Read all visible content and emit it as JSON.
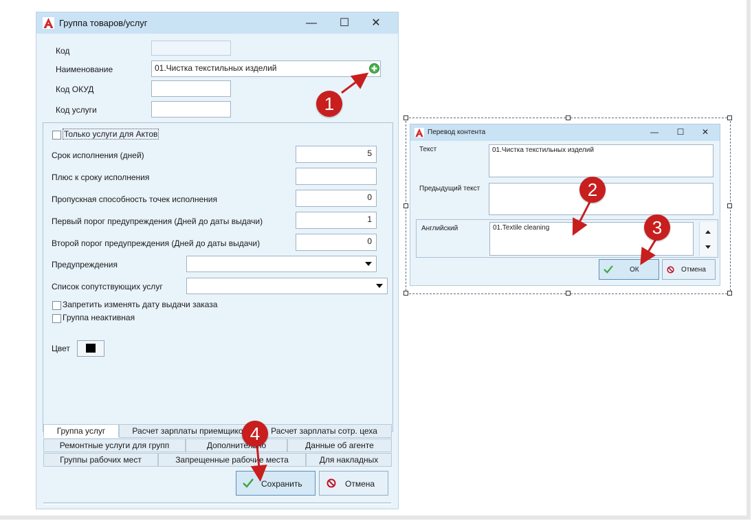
{
  "main_window": {
    "title": "Группа товаров/услуг",
    "controls": {
      "minimize": "—",
      "maximize": "☐",
      "close": "✕"
    },
    "fields": {
      "code_label": "Код",
      "code_value": "",
      "name_label": "Наименование",
      "name_value": "01.Чистка текстильных изделий",
      "okud_label": "Код ОКУД",
      "okud_value": "",
      "service_code_label": "Код услуги",
      "service_code_value": ""
    },
    "panel": {
      "only_acts_label": "Только услуги для Актов",
      "duration_label": "Срок исполнения (дней)",
      "duration_value": "5",
      "plus_duration_label": "Плюс к сроку исполнения",
      "plus_duration_value": "",
      "throughput_label": "Пропускная способность точек исполнения",
      "throughput_value": "0",
      "warn1_label": "Первый порог предупреждения (Дней до даты выдачи)",
      "warn1_value": "1",
      "warn2_label": "Второй порог предупреждения (Дней до даты выдачи)",
      "warn2_value": "0",
      "warnings_label": "Предупреждения",
      "warnings_value": "",
      "related_label": "Список сопутствующих услуг",
      "related_value": "",
      "forbid_date_label": "Запретить изменять дату выдачи заказа",
      "inactive_label": "Группа неактивная",
      "color_label": "Цвет",
      "color_value": "#000000"
    },
    "tabs_row1": [
      "Группа услуг",
      "Расчет зарплаты приемщико",
      "Расчет зарплаты сотр. цеха"
    ],
    "tabs_row2": [
      "Ремонтные услуги для групп",
      "Дополнительно",
      "Данные об агенте"
    ],
    "tabs_row3": [
      "Группы рабочих мест",
      "Запрещенные рабочие места",
      "Для накладных"
    ],
    "save_label": "Сохранить",
    "cancel_label": "Отмена"
  },
  "dialog": {
    "title": "Перевод контента",
    "text_label": "Текст",
    "text_value": "01.Чистка текстильных изделий",
    "prev_label": "Предыдущий текст",
    "prev_value": "",
    "english_label": "Английский",
    "english_value": "01.Textile cleaning",
    "ok_label": "ОК",
    "cancel_label": "Отмена"
  },
  "markers": [
    "1",
    "2",
    "3",
    "4"
  ],
  "colors": {
    "marker": "#c81e1e",
    "titlebar": "#c9e2f4",
    "window_bg": "#e9f3fa",
    "check_green": "#3aa53a",
    "cancel_red": "#c0162a"
  }
}
